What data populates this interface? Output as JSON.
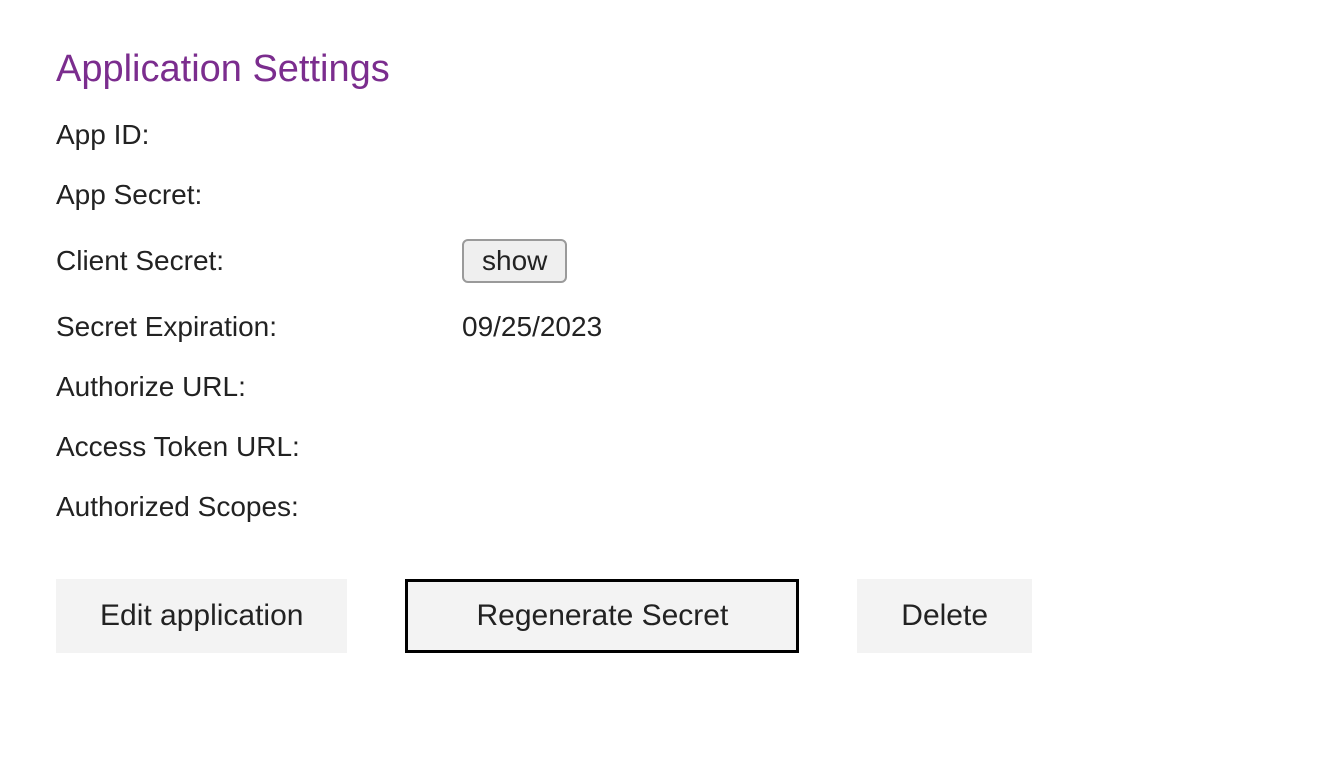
{
  "title": "Application Settings",
  "fields": {
    "app_id": {
      "label": "App ID:",
      "value": ""
    },
    "app_secret": {
      "label": "App Secret:",
      "value": ""
    },
    "client_secret": {
      "label": "Client Secret:",
      "show_label": "show"
    },
    "secret_expiration": {
      "label": "Secret Expiration:",
      "value": "09/25/2023"
    },
    "authorize_url": {
      "label": "Authorize URL:",
      "value": ""
    },
    "access_token_url": {
      "label": "Access Token URL:",
      "value": ""
    },
    "authorized_scopes": {
      "label": "Authorized Scopes:",
      "value": ""
    }
  },
  "actions": {
    "edit": "Edit application",
    "regenerate": "Regenerate Secret",
    "delete": "Delete"
  }
}
